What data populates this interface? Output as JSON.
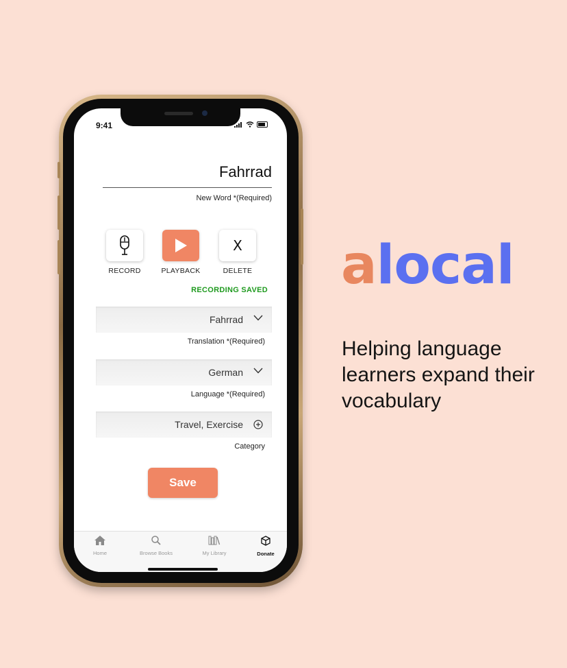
{
  "status_bar": {
    "time": "9:41"
  },
  "new_word": {
    "value": "Fahrrad",
    "label": "New Word *(Required)"
  },
  "actions": [
    {
      "label": "RECORD",
      "icon": "microphone-icon"
    },
    {
      "label": "PLAYBACK",
      "icon": "play-icon"
    },
    {
      "label": "DELETE",
      "icon": "close-icon",
      "glyph": "X"
    }
  ],
  "recording_status": "RECORDING SAVED",
  "fields": {
    "translation": {
      "value": "Fahrrad",
      "label": "Translation *(Required)",
      "icon": "chevron-down-icon"
    },
    "language": {
      "value": "German",
      "label": "Language *(Required)",
      "icon": "chevron-down-icon"
    },
    "category": {
      "value": "Travel, Exercise",
      "label": "Category",
      "icon": "plus-circle-icon"
    }
  },
  "save_label": "Save",
  "tabs": [
    {
      "label": "Home",
      "icon": "home-icon"
    },
    {
      "label": "Browse Books",
      "icon": "search-icon"
    },
    {
      "label": "My Library",
      "icon": "library-icon"
    },
    {
      "label": "Donate",
      "icon": "box-icon",
      "active": true
    }
  ],
  "brand": {
    "logo_first": "a",
    "logo_rest": "local",
    "tagline": "Helping language learners expand their vocabulary"
  },
  "colors": {
    "background": "#fce0d4",
    "accent": "#f08664",
    "brand_blue": "#5b70f0",
    "success": "#1f9a1f"
  }
}
